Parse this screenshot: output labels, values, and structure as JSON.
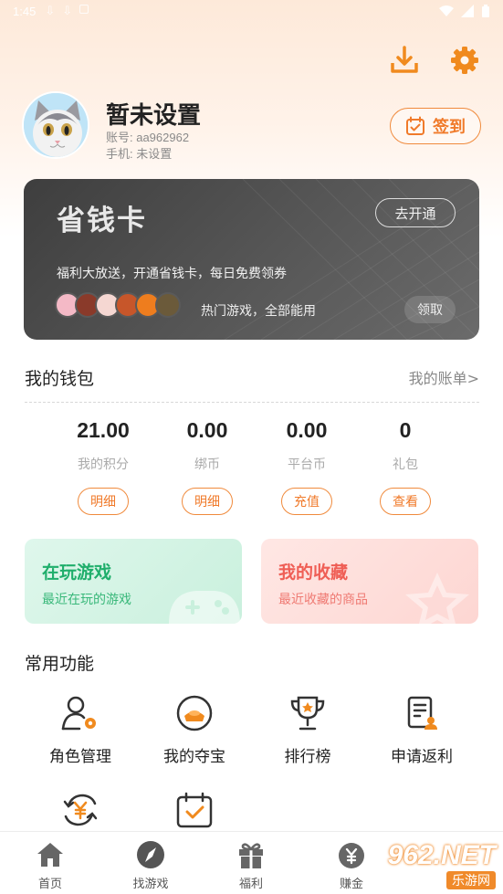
{
  "statusbar": {
    "time": "1:45"
  },
  "profile": {
    "name": "暂未设置",
    "account_line": "账号: aa962962",
    "phone_line": "手机: 未设置",
    "signin_label": "签到"
  },
  "save_card": {
    "title": "省钱卡",
    "open_label": "去开通",
    "desc": "福利大放送，开通省钱卡，每日免费领券",
    "hot_text": "热门游戏，全部能用",
    "claim_label": "领取",
    "game_colors": [
      "#f4b9c6",
      "#8a3a2a",
      "#f5d7d2",
      "#c7562a",
      "#ee7d1e",
      "#6b5a3a"
    ]
  },
  "wallet": {
    "title": "我的钱包",
    "account_link": "我的账单>",
    "items": [
      {
        "value": "21.00",
        "label": "我的积分",
        "button": "明细"
      },
      {
        "value": "0.00",
        "label": "绑币",
        "button": "明细"
      },
      {
        "value": "0.00",
        "label": "平台币",
        "button": "充值"
      },
      {
        "value": "0",
        "label": "礼包",
        "button": "查看"
      }
    ]
  },
  "tiles": {
    "playing": {
      "title": "在玩游戏",
      "subtitle": "最近在玩的游戏"
    },
    "favorites": {
      "title": "我的收藏",
      "subtitle": "最近收藏的商品"
    }
  },
  "functions": {
    "title": "常用功能",
    "items": [
      {
        "label": "角色管理",
        "icon": "role-icon"
      },
      {
        "label": "我的夺宝",
        "icon": "treasure-icon"
      },
      {
        "label": "排行榜",
        "icon": "trophy-icon"
      },
      {
        "label": "申请返利",
        "icon": "rebate-icon"
      },
      {
        "label": "",
        "icon": "yuan-cycle-icon"
      },
      {
        "label": "",
        "icon": "calendar-check-icon"
      }
    ]
  },
  "tabbar": {
    "items": [
      {
        "label": "首页",
        "icon": "home-icon"
      },
      {
        "label": "找游戏",
        "icon": "compass-icon"
      },
      {
        "label": "福利",
        "icon": "gift-icon"
      },
      {
        "label": "赚金",
        "icon": "money-bag-icon"
      }
    ]
  },
  "watermark": {
    "big": "962.NET",
    "small": "乐游网"
  },
  "colors": {
    "accent": "#f07a2a",
    "green": "#1fae6b",
    "red": "#ef5e55"
  }
}
